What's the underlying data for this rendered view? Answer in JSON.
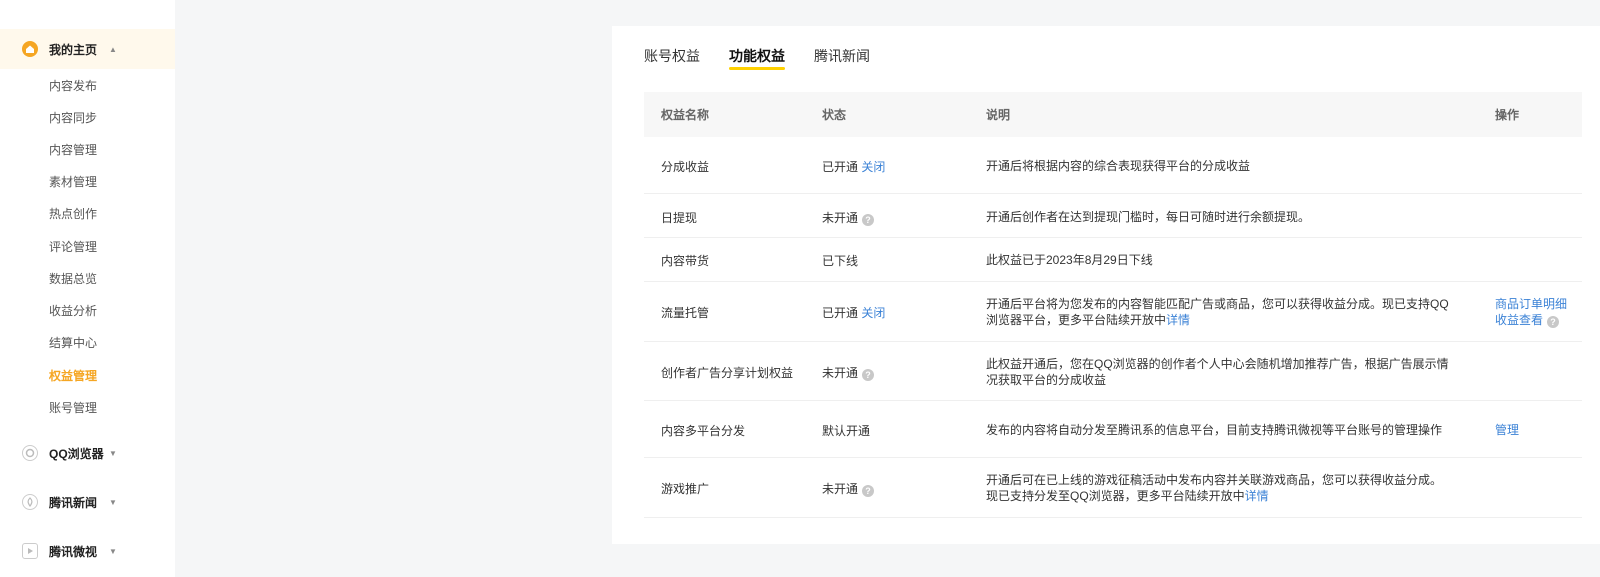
{
  "sidebar": {
    "groups": [
      {
        "title": "我的主页",
        "icon": "home-icon"
      },
      {
        "title": "QQ浏览器",
        "icon": "qq-browser-icon"
      },
      {
        "title": "腾讯新闻",
        "icon": "tencent-news-icon"
      },
      {
        "title": "腾讯微视",
        "icon": "weishi-icon"
      }
    ],
    "items": [
      "内容发布",
      "内容同步",
      "内容管理",
      "素材管理",
      "热点创作",
      "评论管理",
      "数据总览",
      "收益分析",
      "结算中心",
      "权益管理",
      "账号管理"
    ],
    "active_item": "权益管理"
  },
  "tabs": [
    "账号权益",
    "功能权益",
    "腾讯新闻"
  ],
  "active_tab": "功能权益",
  "table": {
    "headers": {
      "name": "权益名称",
      "status": "状态",
      "desc": "说明",
      "op": "操作"
    },
    "rows": [
      {
        "name": "分成收益",
        "status": "已开通",
        "status_link": "关闭",
        "desc": "开通后将根据内容的综合表现获得平台的分成收益"
      },
      {
        "name": "日提现",
        "status": "未开通",
        "desc": "开通后创作者在达到提现门槛时，每日可随时进行余额提现。"
      },
      {
        "name": "内容带货",
        "status": "已下线",
        "desc": "此权益已于2023年8月29日下线"
      },
      {
        "name": "流量托管",
        "status": "已开通",
        "status_link": "关闭",
        "desc": "开通后平台将为您发布的内容智能匹配广告或商品，您可以获得收益分成。现已支持QQ浏览器平台，更多平台陆续开放中",
        "desc_link": "详情",
        "op1": "商品订单明细",
        "op2": "收益查看"
      },
      {
        "name": "创作者广告分享计划权益",
        "status": "未开通",
        "desc": "此权益开通后，您在QQ浏览器的创作者个人中心会随机增加推荐广告，根据广告展示情况获取平台的分成收益"
      },
      {
        "name": "内容多平台分发",
        "status": "默认开通",
        "desc": "发布的内容将自动分发至腾讯系的信息平台，目前支持腾讯微视等平台账号的管理操作",
        "op1": "管理"
      },
      {
        "name": "游戏推广",
        "status": "未开通",
        "desc": "开通后可在已上线的游戏征稿活动中发布内容并关联游戏商品，您可以获得收益分成。现已支持分发至QQ浏览器，更多平台陆续开放中",
        "desc_link": "详情"
      }
    ]
  },
  "colors": {
    "accent": "#f5a623",
    "tab_underline": "#ffd100",
    "link": "#3b82d6"
  }
}
